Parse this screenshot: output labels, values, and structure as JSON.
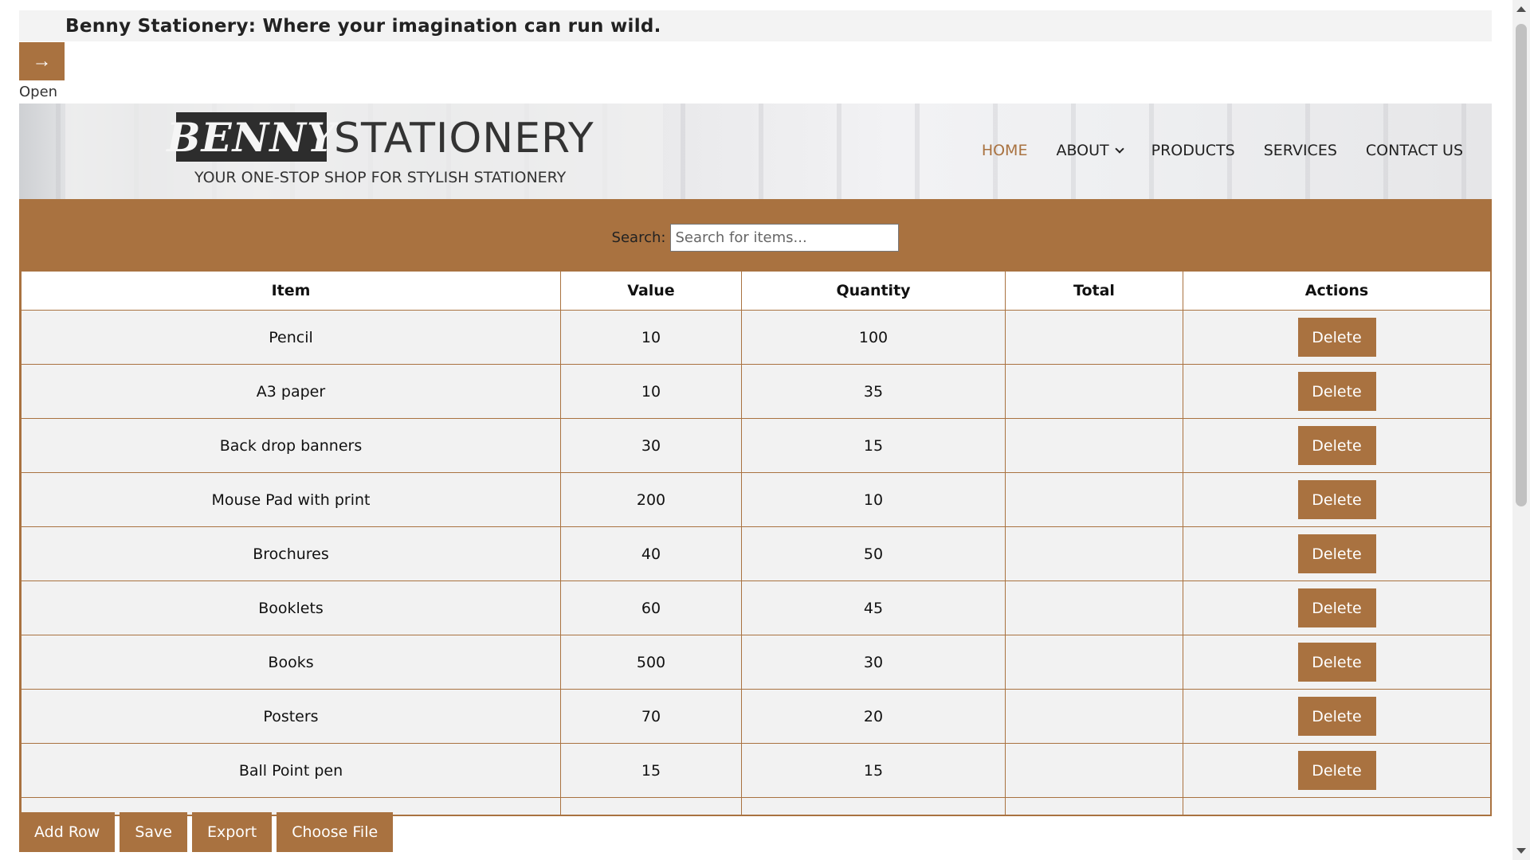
{
  "tagline": "Benny Stationery: Where your imagination can run wild.",
  "open_button": {
    "icon": "→",
    "label": "Open"
  },
  "header": {
    "logo_main": "BENNY",
    "logo_word": "STATIONERY",
    "logo_sub": "YOUR ONE-STOP SHOP FOR STYLISH STATIONERY",
    "nav": [
      {
        "label": "HOME"
      },
      {
        "label": "ABOUT"
      },
      {
        "label": "PRODUCTS"
      },
      {
        "label": "SERVICES"
      },
      {
        "label": "CONTACT US"
      }
    ]
  },
  "search": {
    "label": "Search:",
    "placeholder": "Search for items...",
    "value": ""
  },
  "table": {
    "headers": [
      "Item",
      "Value",
      "Quantity",
      "Total",
      "Actions"
    ],
    "rows": [
      {
        "item": "Pencil",
        "value": "10",
        "quantity": "100",
        "total": ""
      },
      {
        "item": "A3 paper",
        "value": "10",
        "quantity": "35",
        "total": ""
      },
      {
        "item": "Back drop banners",
        "value": "30",
        "quantity": "15",
        "total": ""
      },
      {
        "item": "Mouse Pad with print",
        "value": "200",
        "quantity": "10",
        "total": ""
      },
      {
        "item": "Brochures",
        "value": "40",
        "quantity": "50",
        "total": ""
      },
      {
        "item": "Booklets",
        "value": "60",
        "quantity": "45",
        "total": ""
      },
      {
        "item": "Books",
        "value": "500",
        "quantity": "30",
        "total": ""
      },
      {
        "item": "Posters",
        "value": "70",
        "quantity": "20",
        "total": ""
      },
      {
        "item": "Ball Point pen",
        "value": "15",
        "quantity": "15",
        "total": ""
      }
    ],
    "delete_label": "Delete"
  },
  "toolbar": {
    "add_row": "Add Row",
    "save": "Save",
    "export": "Export",
    "choose_file": "Choose File"
  },
  "colors": {
    "accent": "#a97240",
    "tagline_bg": "#f3f3f3",
    "row_bg": "#f2f2f2"
  }
}
